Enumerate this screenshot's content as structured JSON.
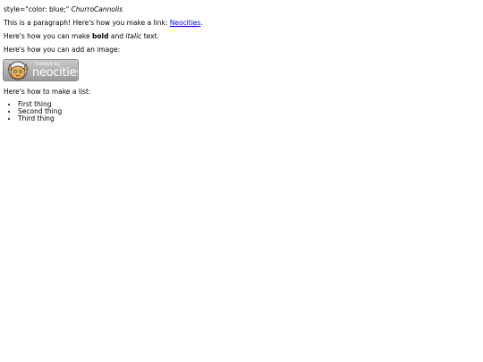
{
  "lines": {
    "style_text": "style=\"color: blue;\"",
    "style_name": "ChurroCannolis",
    "paragraph_prefix": "This is a paragraph! Here's how you make a link:",
    "link_text": "Neocities",
    "period": ".",
    "bold_prefix": "Here's how you can make",
    "bold_word": "bold",
    "and_word": "and",
    "italic_word": "italic",
    "text_suffix": "text.",
    "image_intro": "Here's how you can add an image:",
    "list_intro": "Here's how to make a list:"
  },
  "badge": {
    "hosted_text": "hosted by",
    "brand_text": "neocities",
    "icon": "neocities-cat-logo",
    "bg": "#b0b0b0"
  },
  "list": {
    "items": [
      "First thing",
      "Second thing",
      "Third thing"
    ]
  },
  "colors": {
    "link": "#0000ee",
    "text": "#000000",
    "background": "#ffffff"
  }
}
